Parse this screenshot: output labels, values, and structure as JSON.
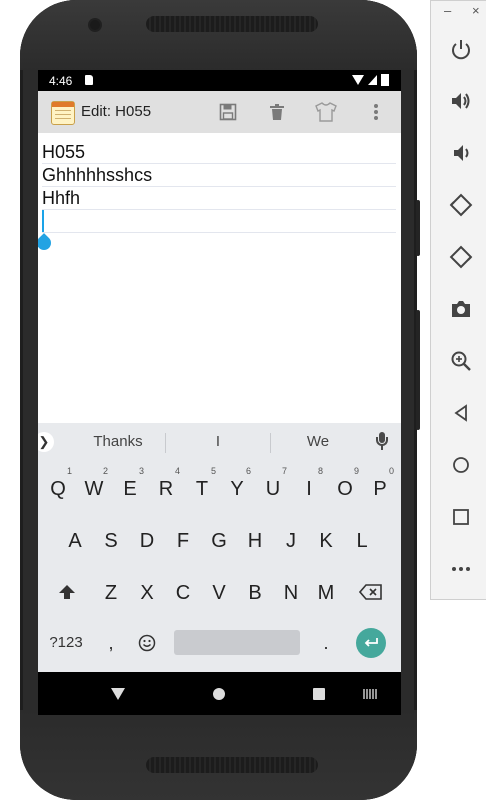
{
  "statusbar": {
    "time": "4:46"
  },
  "appbar": {
    "title": "Edit: H055"
  },
  "editor": {
    "lines": [
      "H055",
      "Ghhhhhsshcs",
      "Hhfh",
      ""
    ]
  },
  "keyboard": {
    "suggestions": [
      "Thanks",
      "I",
      "We"
    ],
    "row1": [
      {
        "k": "Q",
        "h": "1"
      },
      {
        "k": "W",
        "h": "2"
      },
      {
        "k": "E",
        "h": "3"
      },
      {
        "k": "R",
        "h": "4"
      },
      {
        "k": "T",
        "h": "5"
      },
      {
        "k": "Y",
        "h": "6"
      },
      {
        "k": "U",
        "h": "7"
      },
      {
        "k": "I",
        "h": "8"
      },
      {
        "k": "O",
        "h": "9"
      },
      {
        "k": "P",
        "h": "0"
      }
    ],
    "row2": [
      "A",
      "S",
      "D",
      "F",
      "G",
      "H",
      "J",
      "K",
      "L"
    ],
    "row3": [
      "Z",
      "X",
      "C",
      "V",
      "B",
      "N",
      "M"
    ],
    "symbols_label": "?123",
    "comma": ",",
    "period": "."
  },
  "window_controls": {
    "minimize": "–",
    "close": "×"
  },
  "emulator_panel": [
    "power-icon",
    "volume-up-icon",
    "volume-down-icon",
    "rotate-left-icon",
    "rotate-right-icon",
    "camera-icon",
    "zoom-icon",
    "back-icon",
    "home-icon",
    "overview-icon",
    "more-icon"
  ]
}
